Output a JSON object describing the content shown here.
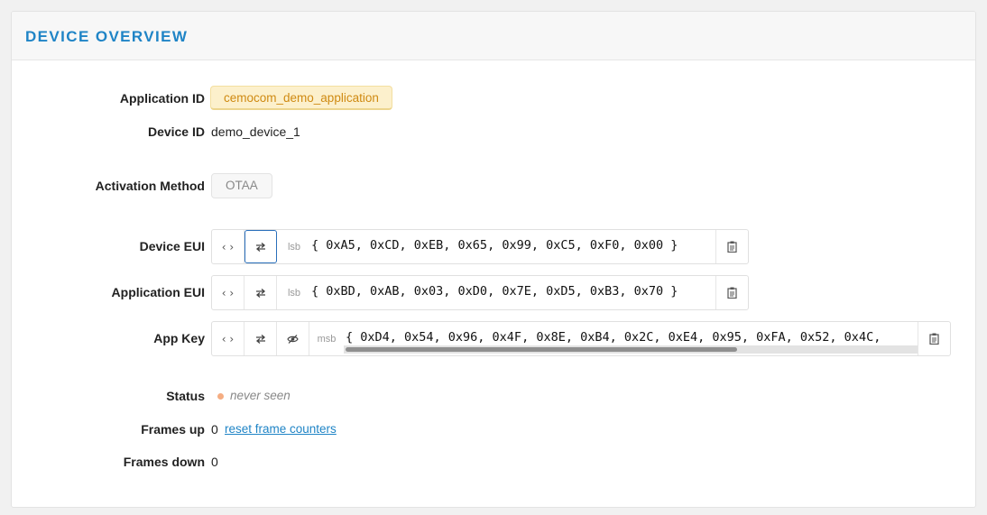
{
  "card": {
    "title": "DEVICE OVERVIEW"
  },
  "fields": {
    "application_id": {
      "label": "Application ID",
      "value": "cemocom_demo_application"
    },
    "device_id": {
      "label": "Device ID",
      "value": "demo_device_1"
    },
    "activation_method": {
      "label": "Activation Method",
      "value": "OTAA"
    },
    "device_eui": {
      "label": "Device EUI",
      "byte_order": "lsb",
      "value": "{ 0xA5, 0xCD, 0xEB, 0x65, 0x99, 0xC5, 0xF0, 0x00 }"
    },
    "application_eui": {
      "label": "Application EUI",
      "byte_order": "lsb",
      "value": "{ 0xBD, 0xAB, 0x03, 0xD0, 0x7E, 0xD5, 0xB3, 0x70 }"
    },
    "app_key": {
      "label": "App Key",
      "byte_order": "msb",
      "value": "{ 0xD4, 0x54, 0x96, 0x4F, 0x8E, 0xB4, 0x2C, 0xE4, 0x95, 0xFA, 0x52, 0x4C,",
      "scroll_position": 0.64
    },
    "status": {
      "label": "Status",
      "value": "never seen",
      "color": "#f5ad82"
    },
    "frames_up": {
      "label": "Frames up",
      "value": "0",
      "reset_link": "reset frame counters"
    },
    "frames_down": {
      "label": "Frames down",
      "value": "0"
    }
  },
  "icons": {
    "toggle_format": "code-brackets-icon",
    "swap_order": "swap-arrows-icon",
    "visibility": "eye-slash-icon",
    "copy": "clipboard-icon"
  },
  "colors": {
    "title": "#1f84c6",
    "link": "#1f84c6",
    "app_tag_bg": "#fcf0cc",
    "app_tag_text": "#cf8a12"
  }
}
